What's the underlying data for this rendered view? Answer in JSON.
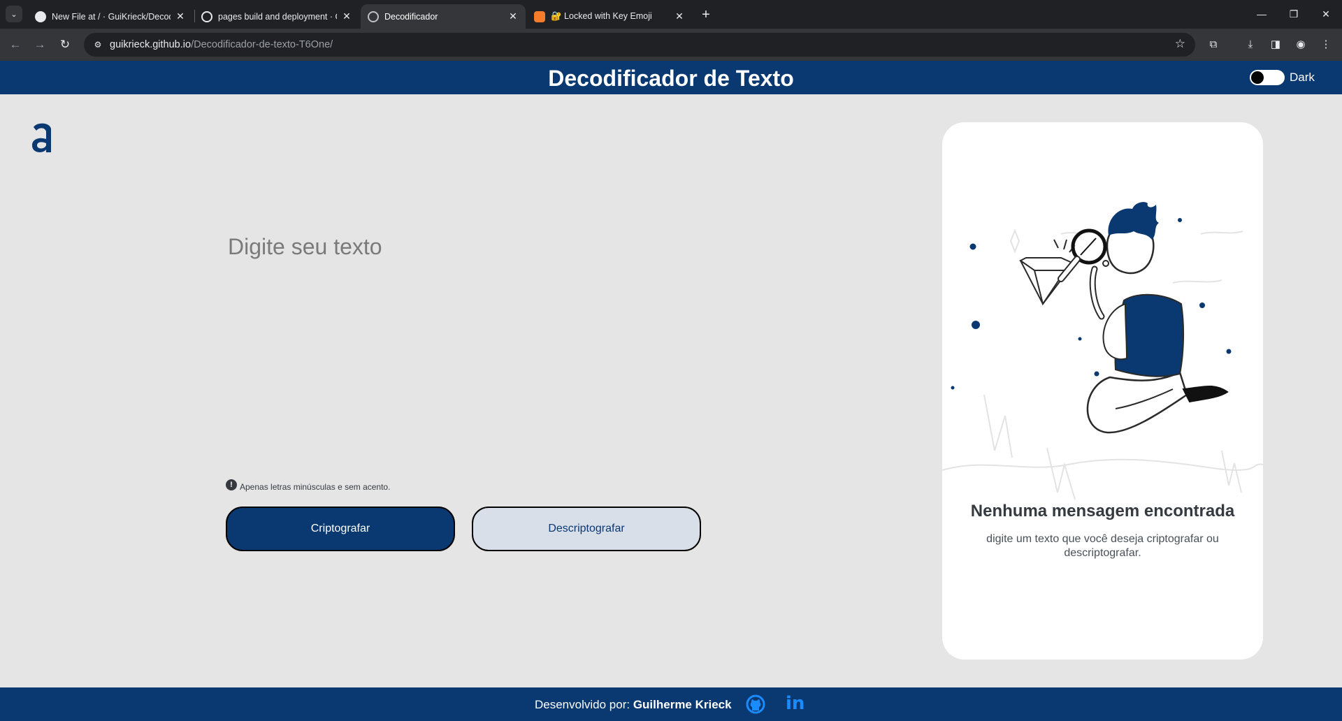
{
  "browser": {
    "tabs": [
      {
        "title": "New File at / · GuiKrieck/Decodificador",
        "icon": "github-icon",
        "active": false
      },
      {
        "title": "pages build and deployment · GuiKrieck",
        "icon": "github-actions-icon",
        "active": false
      },
      {
        "title": "Decodificador",
        "icon": "globe-icon",
        "active": true
      },
      {
        "title": "🔐 Locked with Key Emoji",
        "icon": "emojipedia-icon",
        "active": false
      }
    ],
    "url_host": "guikrieck.github.io",
    "url_path": "/Decodificador-de-texto-T6One/"
  },
  "header": {
    "title": "Decodificador de Texto",
    "theme_toggle_label": "Dark",
    "theme_dark_enabled": false
  },
  "logo": {
    "icon": "alura-logo-icon"
  },
  "main": {
    "input_placeholder": "Digite seu texto",
    "input_value": "",
    "hint_icon": "exclamation-circle-icon",
    "hint_text": "Apenas letras minúsculas e sem acento.",
    "encrypt_label": "Criptografar",
    "decrypt_label": "Descriptografar"
  },
  "output": {
    "illustration": "person-with-magnifier-illustration",
    "title": "Nenhuma mensagem encontrada",
    "text": "digite um texto que você deseja criptografar ou descriptografar."
  },
  "footer": {
    "prefix": "Desenvolvido por: ",
    "author": "Guilherme Krieck",
    "github_icon": "github-icon",
    "linkedin_icon": "linkedin-icon"
  },
  "colors": {
    "brand": "#0a3871",
    "background": "#e5e5e5",
    "panel": "#ffffff",
    "secondary_button": "#d8dfe8"
  }
}
